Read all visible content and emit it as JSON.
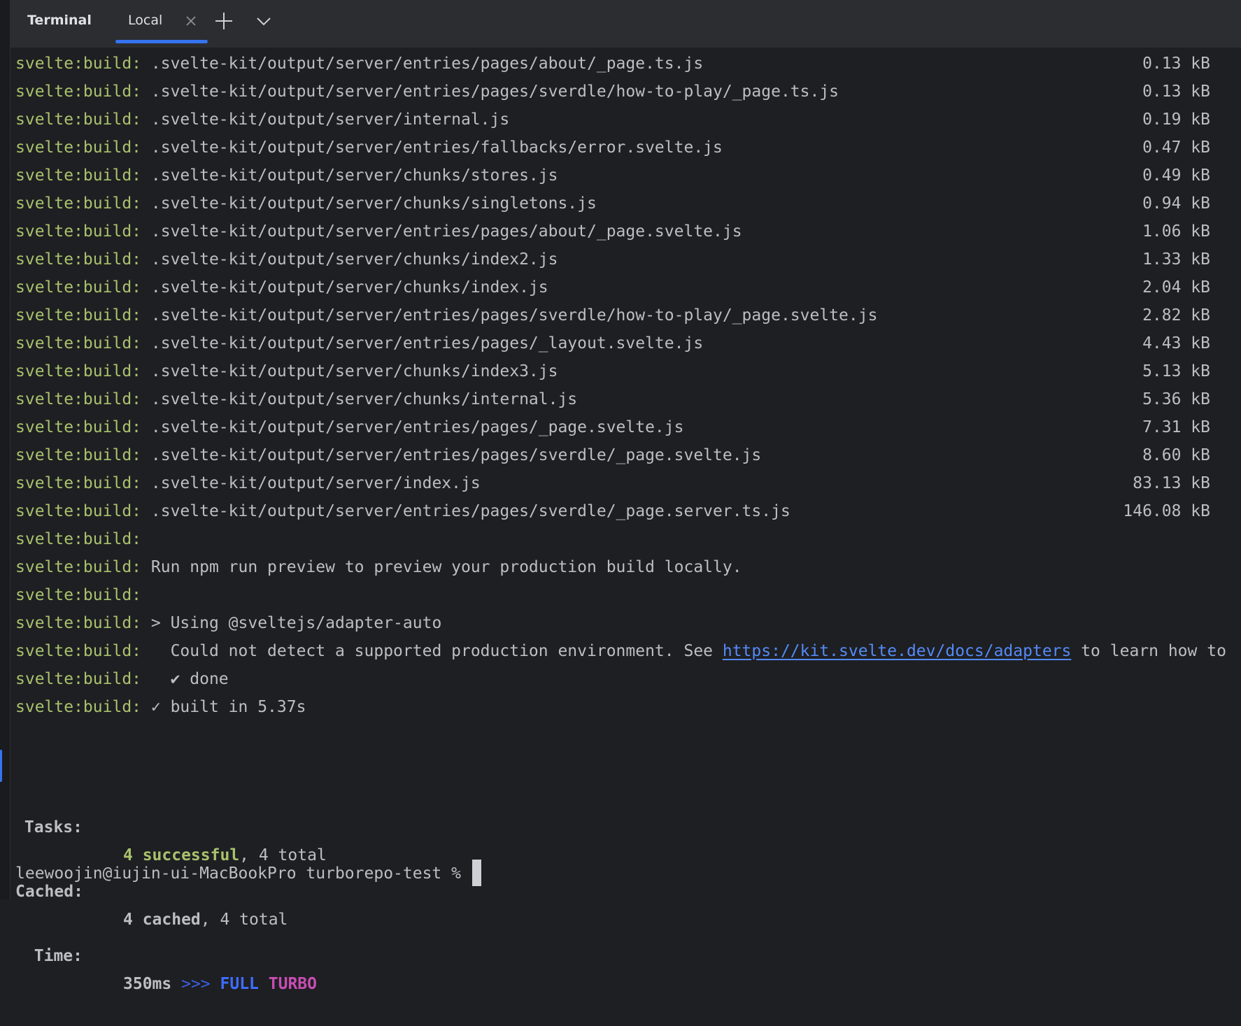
{
  "header": {
    "title": "Terminal",
    "tab_label": "Local",
    "close_icon": "close-icon",
    "add_icon": "plus-icon",
    "dropdown_icon": "chevron-down-icon"
  },
  "colors": {
    "background": "#1e1f22",
    "header_background": "#2b2d30",
    "prefix_green": "#a9c26d",
    "link_blue": "#548af7",
    "accent_blue": "#3574f0",
    "turbo_magenta": "#c84db3"
  },
  "output": {
    "prefix": "svelte:build:",
    "files": [
      {
        "path": ".svelte-kit/output/server/entries/pages/about/_page.ts.js",
        "size": "0.13 kB"
      },
      {
        "path": ".svelte-kit/output/server/entries/pages/sverdle/how-to-play/_page.ts.js",
        "size": "0.13 kB"
      },
      {
        "path": ".svelte-kit/output/server/internal.js",
        "size": "0.19 kB"
      },
      {
        "path": ".svelte-kit/output/server/entries/fallbacks/error.svelte.js",
        "size": "0.47 kB"
      },
      {
        "path": ".svelte-kit/output/server/chunks/stores.js",
        "size": "0.49 kB"
      },
      {
        "path": ".svelte-kit/output/server/chunks/singletons.js",
        "size": "0.94 kB"
      },
      {
        "path": ".svelte-kit/output/server/entries/pages/about/_page.svelte.js",
        "size": "1.06 kB"
      },
      {
        "path": ".svelte-kit/output/server/chunks/index2.js",
        "size": "1.33 kB"
      },
      {
        "path": ".svelte-kit/output/server/chunks/index.js",
        "size": "2.04 kB"
      },
      {
        "path": ".svelte-kit/output/server/entries/pages/sverdle/how-to-play/_page.svelte.js",
        "size": "2.82 kB"
      },
      {
        "path": ".svelte-kit/output/server/entries/pages/_layout.svelte.js",
        "size": "4.43 kB"
      },
      {
        "path": ".svelte-kit/output/server/chunks/index3.js",
        "size": "5.13 kB"
      },
      {
        "path": ".svelte-kit/output/server/chunks/internal.js",
        "size": "5.36 kB"
      },
      {
        "path": ".svelte-kit/output/server/entries/pages/_page.svelte.js",
        "size": "7.31 kB"
      },
      {
        "path": ".svelte-kit/output/server/entries/pages/sverdle/_page.svelte.js",
        "size": "8.60 kB"
      },
      {
        "path": ".svelte-kit/output/server/index.js",
        "size": "83.13 kB"
      },
      {
        "path": ".svelte-kit/output/server/entries/pages/sverdle/_page.server.ts.js",
        "size": "146.08 kB"
      }
    ],
    "preview_msg": "Run npm run preview to preview your production build locally.",
    "adapter_msg": "> Using @sveltejs/adapter-auto",
    "detect_msg_before": "  Could not detect a supported production environment. See ",
    "detect_link": "https://kit.svelte.dev/docs/adapters",
    "detect_msg_after": " to learn how to",
    "done_msg": "  ✔ done",
    "built_msg": "✓ built in 5.37s"
  },
  "summary": {
    "tasks_label": "Tasks:",
    "tasks_success": "4 successful",
    "tasks_total": ", 4 total",
    "cached_label": "Cached:",
    "cached_count": "4 cached",
    "cached_total": ", 4 total",
    "time_label": "Time:",
    "time_value": "350ms",
    "time_arrows": ">>>",
    "full_word": "FULL",
    "turbo_word": "TURBO"
  },
  "prompt": {
    "text": "leewoojin@iujin-ui-MacBookPro turborepo-test % "
  }
}
